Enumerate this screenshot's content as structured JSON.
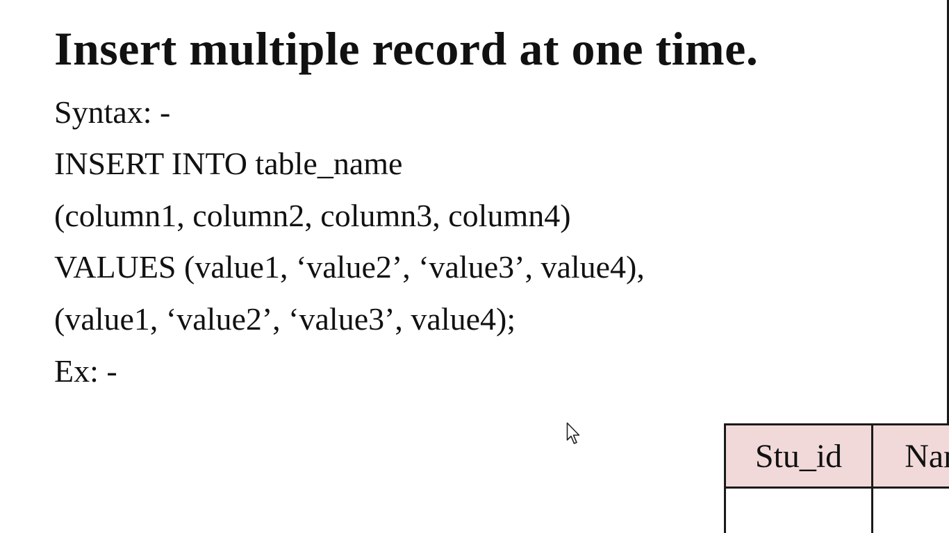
{
  "slide": {
    "title": "Insert multiple record at one time.",
    "lines": [
      "Syntax: -",
      "INSERT INTO table_name",
      "(column1, column2, column3, column4)",
      "VALUES (value1, ‘value2’, ‘value3’, value4),",
      "(value1, ‘value2’, ‘value3’, value4);",
      "Ex: -"
    ]
  },
  "table": {
    "headers": [
      "Stu_id",
      "Name"
    ],
    "header_color": "#f2d9d9",
    "border_color": "#1a1a1a"
  },
  "cursor": {
    "icon": "mouse-pointer-icon"
  }
}
